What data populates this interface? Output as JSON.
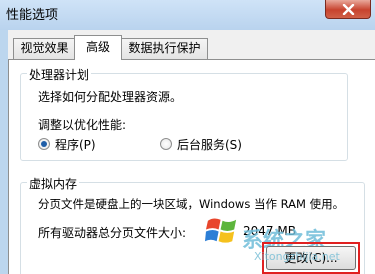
{
  "window": {
    "title": "性能选项",
    "close_icon": "close-icon"
  },
  "tabs": [
    {
      "label": "视觉效果",
      "active": false
    },
    {
      "label": "高级",
      "active": true
    },
    {
      "label": "数据执行保护",
      "active": false
    }
  ],
  "processor": {
    "group_label": "处理器计划",
    "description": "选择如何分配处理器资源。",
    "adjust_label": "调整以优化性能:",
    "options": [
      {
        "label": "程序(P)",
        "checked": true
      },
      {
        "label": "后台服务(S)",
        "checked": false
      }
    ]
  },
  "virtual_memory": {
    "group_label": "虚拟内存",
    "description": "分页文件是硬盘上的一块区域，Windows 当作 RAM 使用。",
    "total_label": "所有驱动器总分页文件大小:",
    "total_value": "2047 MB",
    "change_button": "更改(C)..."
  },
  "watermark": {
    "text": "系统之家",
    "url": "Xitongzhijia.net",
    "logo_icon": "windows-logo-icon"
  },
  "colors": {
    "accent": "#1f5ea8",
    "highlight": "#e02020",
    "titlebar": "#bcd6ee"
  }
}
